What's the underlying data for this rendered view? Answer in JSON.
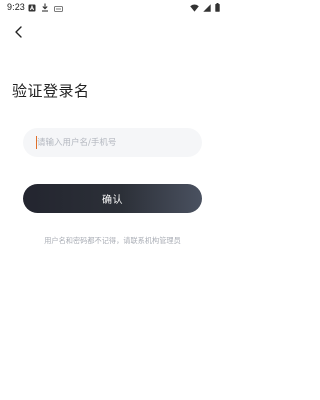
{
  "status_bar": {
    "time": "9:23",
    "left_icons": [
      "notification-a-icon",
      "download-icon",
      "dash-icon"
    ],
    "right_icons": [
      "wifi-icon",
      "signal-icon",
      "battery-icon"
    ]
  },
  "header": {
    "back_icon": "chevron-left-icon"
  },
  "page": {
    "title": "验证登录名"
  },
  "form": {
    "username_value": "",
    "username_placeholder": "请输入用户名/手机号",
    "confirm_label": "确认"
  },
  "hint": {
    "text": "用户名和密码都不记得，请联系机构管理员"
  },
  "colors": {
    "caret": "#e0702b",
    "button_start": "#23252f",
    "button_end": "#4a5160",
    "input_bg": "#f5f6f8",
    "hint": "#a9adb5"
  }
}
